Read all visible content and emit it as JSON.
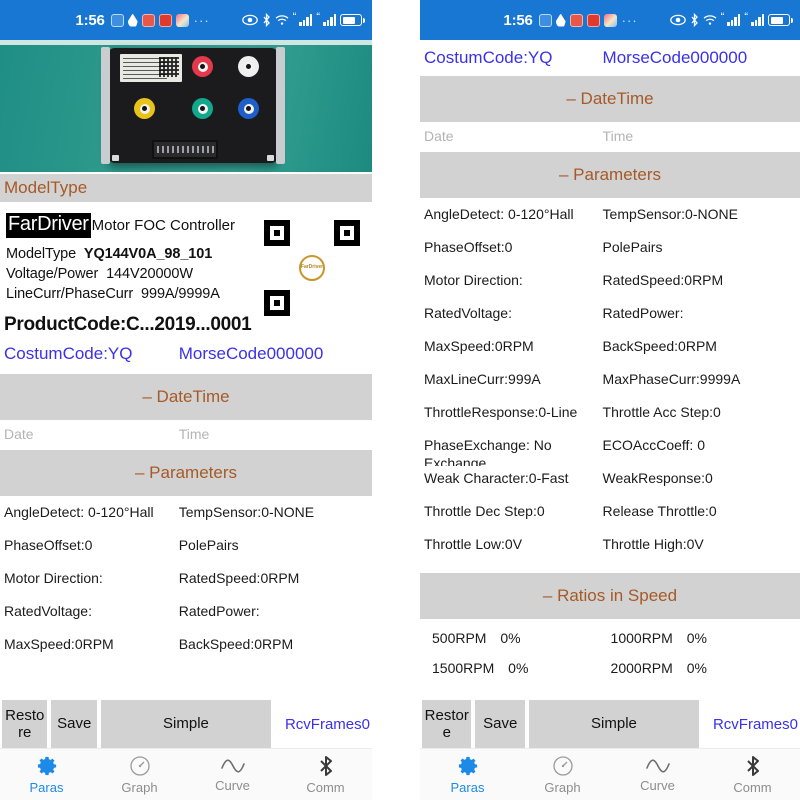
{
  "status_bar": {
    "time": "1:56",
    "left_icons": [
      "app-badge-icon",
      "notification-drop-icon",
      "alert-red-icon",
      "mail-red-icon",
      "gallery-icon"
    ],
    "overflow": "···",
    "right_icons": [
      "eye-icon",
      "bluetooth-icon",
      "wifi-icon",
      "signal-1-icon",
      "signal-2-icon",
      "battery-icon"
    ]
  },
  "photo": {
    "alt": "FarDriver motor FOC controller product photo",
    "background_color": "#2e9a8c",
    "terminal_colors": [
      "#e3394a",
      "#efefef",
      "#e8c419",
      "#13a88e",
      "#1f5fc9"
    ]
  },
  "sections": {
    "model_type": "ModelType",
    "datetime": "– DateTime",
    "parameters": "– Parameters",
    "ratios": "– Ratios in Speed"
  },
  "label_card": {
    "brand": "FarDriver",
    "brand_subtitle": "Motor FOC Controller",
    "rows": [
      {
        "key": "ModelType",
        "value": "YQ144V0A_98_101"
      },
      {
        "key": "Voltage/Power",
        "value": "144V20000W"
      },
      {
        "key": "LineCurr/PhaseCurr",
        "value": "999A/9999A"
      }
    ],
    "qr_logo_text": "FarDriver"
  },
  "product_code": "ProductCode:C...2019...0001",
  "codes": {
    "costum": "CostumCode:YQ",
    "morse": "MorseCode000000"
  },
  "datetime": {
    "date_placeholder": "Date",
    "time_placeholder": "Time"
  },
  "parameters": [
    {
      "left": "AngleDetect: 0-120°Hall",
      "right": "TempSensor:0-NONE"
    },
    {
      "left": "PhaseOffset:0",
      "right": "PolePairs"
    },
    {
      "left": "Motor Direction:",
      "right": "RatedSpeed:0RPM"
    },
    {
      "left": "RatedVoltage:",
      "right": "RatedPower:"
    },
    {
      "left": "MaxSpeed:0RPM",
      "right": "BackSpeed:0RPM"
    },
    {
      "left": "MaxLineCurr:999A",
      "right": "MaxPhaseCurr:9999A"
    },
    {
      "left": "ThrottleResponse:0-Line",
      "right": "Throttle Acc Step:0"
    },
    {
      "left": "PhaseExchange:  No Exchange",
      "right": "ECOAccCoeff:  0"
    },
    {
      "left": "Weak Character:0-Fast",
      "right": "WeakResponse:0"
    },
    {
      "left": "Throttle Dec Step:0",
      "right": "Release Throttle:0"
    },
    {
      "left": "Throttle Low:0V",
      "right": "Throttle High:0V"
    }
  ],
  "ratios": [
    {
      "left_rpm": "500RPM",
      "left_pct": "0%",
      "right_rpm": "1000RPM",
      "right_pct": "0%"
    },
    {
      "left_rpm": "1500RPM",
      "left_pct": "0%",
      "right_rpm": "2000RPM",
      "right_pct": "0%"
    }
  ],
  "actions": {
    "restore": "Restore",
    "save": "Save",
    "simple": "Simple",
    "rcv_frames": "RcvFrames0"
  },
  "tabs": [
    {
      "label": "Paras",
      "icon": "gear-icon",
      "active": true
    },
    {
      "label": "Graph",
      "icon": "gauge-icon",
      "active": false
    },
    {
      "label": "Curve",
      "icon": "wave-icon",
      "active": false
    },
    {
      "label": "Comm",
      "icon": "bluetooth-icon",
      "active": false
    }
  ],
  "colors": {
    "status_bar": "#1877d2",
    "section_header_bg": "#d2d2d2",
    "section_header_text": "#a55a28",
    "link_blue": "#3b31e8",
    "tab_active": "#1e8ae8"
  }
}
